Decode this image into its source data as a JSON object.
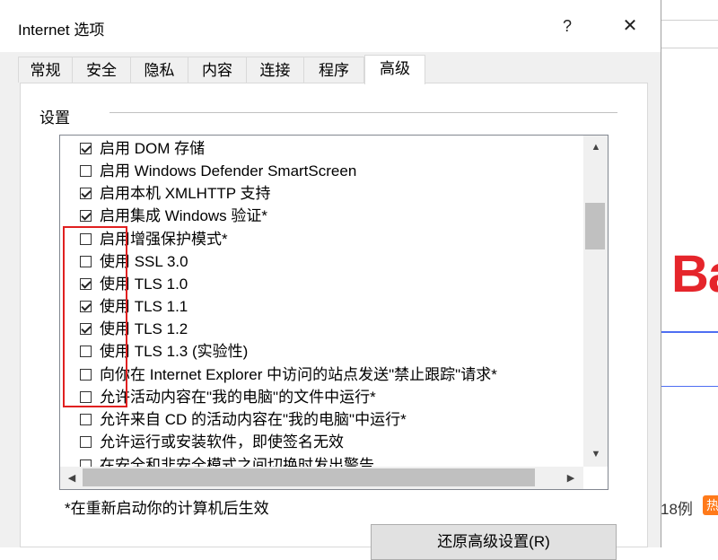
{
  "background": {
    "brand_text": "Ba",
    "count_text": "18例",
    "hot_badge": "热"
  },
  "dialog": {
    "title": "Internet 选项",
    "help_label": "?",
    "close_label": "✕",
    "tabs": [
      "常规",
      "安全",
      "隐私",
      "内容",
      "连接",
      "程序",
      "高级"
    ],
    "active_tab": "高级",
    "group_label": "设置",
    "settings": [
      {
        "label": "启用 DOM 存储",
        "checked": true
      },
      {
        "label": "启用 Windows Defender SmartScreen",
        "checked": false
      },
      {
        "label": "启用本机 XMLHTTP 支持",
        "checked": true
      },
      {
        "label": "启用集成 Windows 验证*",
        "checked": true
      },
      {
        "label": "启用增强保护模式*",
        "checked": false
      },
      {
        "label": "使用 SSL 3.0",
        "checked": false
      },
      {
        "label": "使用 TLS 1.0",
        "checked": true
      },
      {
        "label": "使用 TLS 1.1",
        "checked": true
      },
      {
        "label": "使用 TLS 1.2",
        "checked": true
      },
      {
        "label": "使用 TLS 1.3 (实验性)",
        "checked": false
      },
      {
        "label": "向你在 Internet Explorer 中访问的站点发送\"禁止跟踪\"请求*",
        "checked": false
      },
      {
        "label": "允许活动内容在\"我的电脑\"的文件中运行*",
        "checked": false
      },
      {
        "label": "允许来自 CD 的活动内容在\"我的电脑\"中运行*",
        "checked": false
      },
      {
        "label": "允许运行或安装软件，即使签名无效",
        "checked": false
      },
      {
        "label": "在安全和非安全模式之间切换时发出警告",
        "checked": false
      }
    ],
    "footnote": "*在重新启动你的计算机后生效",
    "restore_button": "还原高级设置(R)"
  },
  "colors": {
    "highlight_box": "#e02020",
    "dialog_bg": "#f0f0f0",
    "brand_red": "#e5252b"
  }
}
